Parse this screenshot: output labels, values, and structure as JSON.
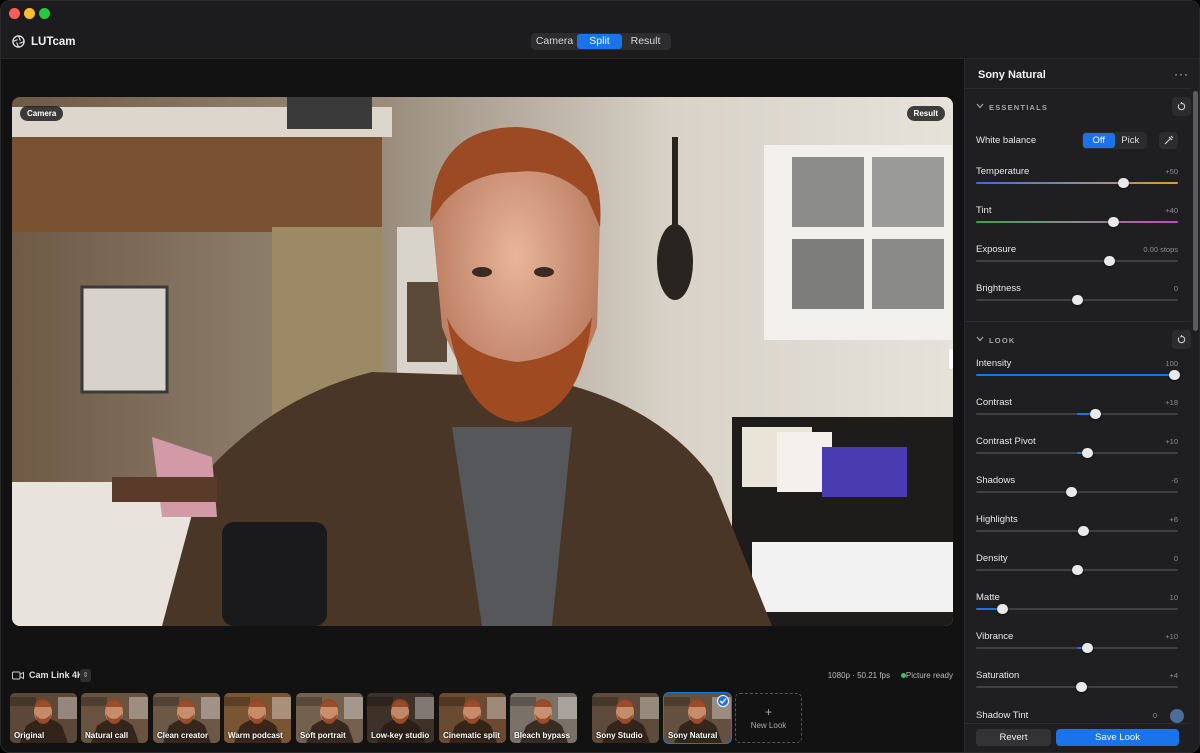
{
  "app": {
    "title": "LUTcam"
  },
  "view_modes": [
    {
      "label": "Camera",
      "active": false
    },
    {
      "label": "Split",
      "active": true
    },
    {
      "label": "Result",
      "active": false
    }
  ],
  "preview": {
    "left_label": "Camera",
    "right_label": "Result"
  },
  "status": {
    "camera_name": "Cam Link 4K",
    "resolution": "1080p · 50.21 fps",
    "ready": "Picture ready"
  },
  "looks": [
    {
      "label": "Original"
    },
    {
      "label": "Natural call"
    },
    {
      "label": "Clean creator"
    },
    {
      "label": "Warm podcast"
    },
    {
      "label": "Soft portrait"
    },
    {
      "label": "Low-key studio"
    },
    {
      "label": "Cinematic split"
    },
    {
      "label": "Bleach bypass"
    },
    {
      "label": "Sony Studio"
    },
    {
      "label": "Sony Natural",
      "selected": true
    }
  ],
  "new_look": {
    "plus": "+",
    "label": "New Look"
  },
  "panel": {
    "title": "Sony Natural",
    "more": "···",
    "essentials": {
      "title": "ESSENTIALS",
      "white_balance": {
        "label": "White balance",
        "options": [
          "Off",
          "Pick"
        ],
        "selected": "Off"
      },
      "sliders": [
        {
          "label": "Temperature",
          "value": "+50",
          "position": 0.73,
          "style": "temperature"
        },
        {
          "label": "Tint",
          "value": "+40",
          "position": 0.68,
          "style": "tint"
        },
        {
          "label": "Exposure",
          "value": "0.00 stops",
          "position": 0.66,
          "style": "plain"
        },
        {
          "label": "Brightness",
          "value": "0",
          "position": 0.5,
          "style": "plain"
        }
      ]
    },
    "look": {
      "title": "LOOK",
      "sliders": [
        {
          "label": "Intensity",
          "value": "100",
          "position": 0.98,
          "style": "fill-left"
        },
        {
          "label": "Contrast",
          "value": "+18",
          "position": 0.59,
          "style": "fill-center"
        },
        {
          "label": "Contrast Pivot",
          "value": "+10",
          "position": 0.55,
          "style": "fill-center"
        },
        {
          "label": "Shadows",
          "value": "-6",
          "position": 0.47,
          "style": "fill-center"
        },
        {
          "label": "Highlights",
          "value": "+6",
          "position": 0.53,
          "style": "fill-center"
        },
        {
          "label": "Density",
          "value": "0",
          "position": 0.5,
          "style": "fill-center"
        },
        {
          "label": "Matte",
          "value": "10",
          "position": 0.13,
          "style": "fill-left"
        },
        {
          "label": "Vibrance",
          "value": "+10",
          "position": 0.55,
          "style": "fill-center"
        },
        {
          "label": "Saturation",
          "value": "+4",
          "position": 0.52,
          "style": "fill-center"
        }
      ],
      "shadow_tint": {
        "label": "Shadow Tint",
        "value": "0"
      }
    }
  },
  "buttons": {
    "revert": "Revert",
    "save": "Save Look"
  },
  "colors": {
    "accent": "#1a73e8",
    "ready": "#35c759"
  }
}
